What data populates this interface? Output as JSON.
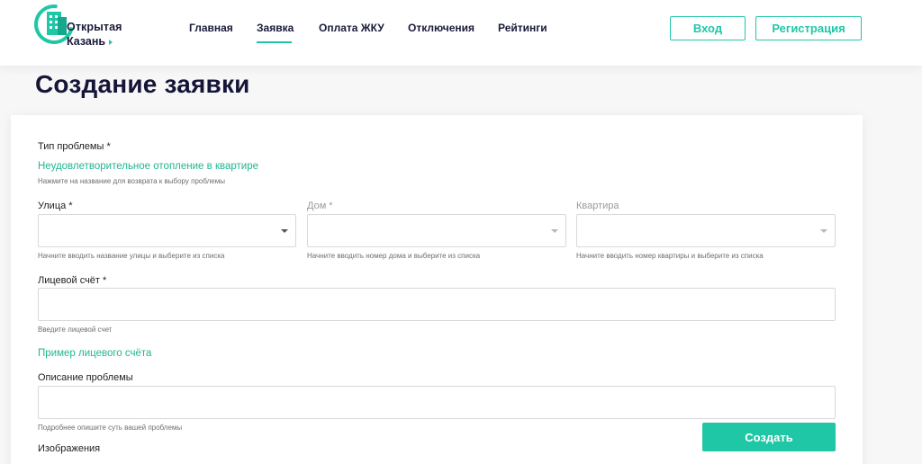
{
  "logo": {
    "line1": "Открытая",
    "line2": "Казань"
  },
  "nav": [
    {
      "label": "Главная"
    },
    {
      "label": "Заявка"
    },
    {
      "label": "Оплата ЖКУ"
    },
    {
      "label": "Отключения"
    },
    {
      "label": "Рейтинги"
    }
  ],
  "auth": {
    "login": "Вход",
    "register": "Регистрация"
  },
  "page": {
    "title": "Создание заявки"
  },
  "form": {
    "problem_type": {
      "label": "Тип проблемы *",
      "value": "Неудовлетворительное отопление в квартире",
      "hint": "Нажмите на название для возврата к выбору проблемы"
    },
    "street": {
      "label": "Улица *",
      "value": "",
      "hint": "Начните вводить название улицы и выберите из списка"
    },
    "house": {
      "label": "Дом *",
      "value": "",
      "hint": "Начните вводить номер дома и выберите из списка"
    },
    "apartment": {
      "label": "Квартира",
      "value": "",
      "hint": "Начните вводить номер квартиры и выберите из списка"
    },
    "account": {
      "label": "Лицевой счёт *",
      "value": "",
      "hint": "Введите лицевой счет"
    },
    "account_example": "Пример лицевого счёта",
    "description": {
      "label": "Описание проблемы",
      "value": "",
      "hint": "Подробнее опишите суть вашей проблемы"
    },
    "images": {
      "label": "Изображения"
    },
    "submit": "Создать"
  },
  "colors": {
    "accent": "#1fc7a6",
    "link": "#1fb78e",
    "title": "#151538"
  }
}
